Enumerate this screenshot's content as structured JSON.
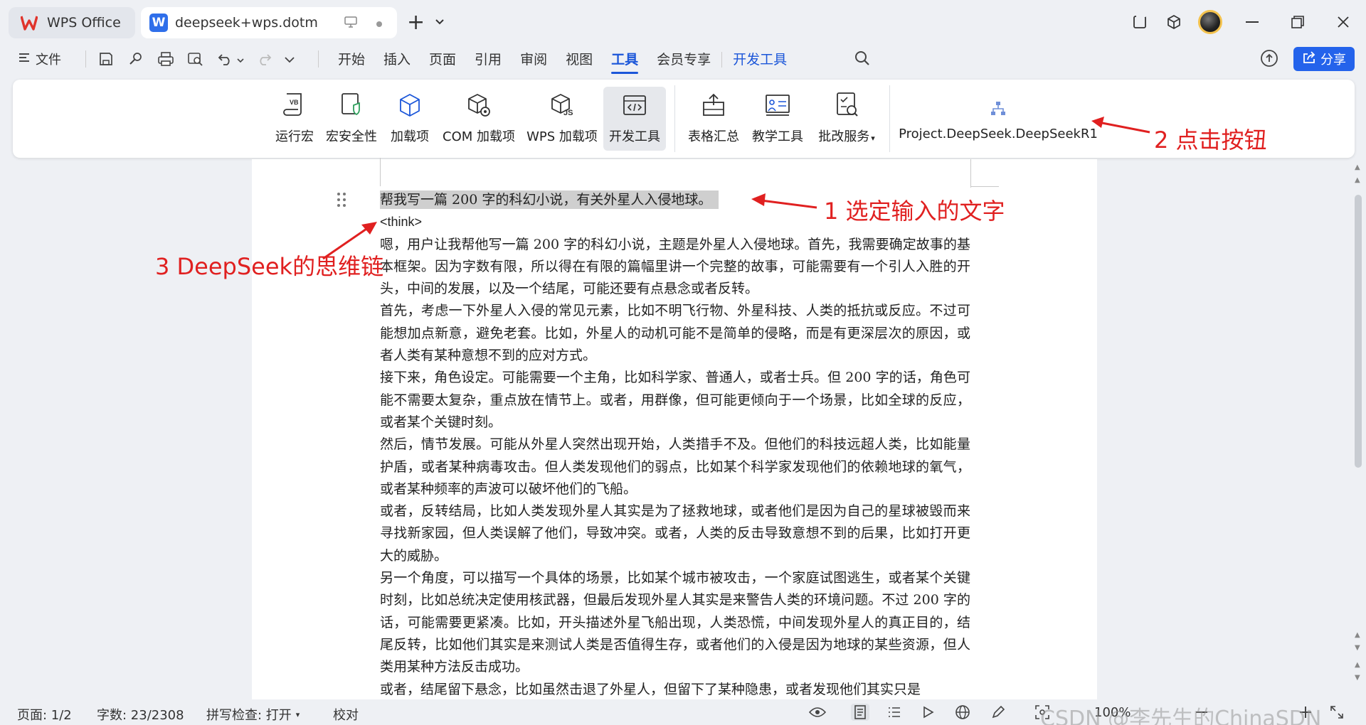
{
  "titlebar": {
    "app_tab": "WPS Office",
    "doc_tab": "deepseek+wps.dotm",
    "new_tab": "+"
  },
  "menubar": {
    "file_label": "文件",
    "items": [
      "开始",
      "插入",
      "页面",
      "引用",
      "审阅",
      "视图",
      "工具",
      "会员专享",
      "开发工具"
    ],
    "active_item": "工具",
    "share_label": "分享"
  },
  "ribbon": {
    "buttons": [
      {
        "label": "运行宏",
        "icon": "vb-script-icon"
      },
      {
        "label": "宏安全性",
        "icon": "macro-shield-icon"
      },
      {
        "label": "加载项",
        "icon": "cube-icon"
      },
      {
        "label": "COM 加载项",
        "icon": "com-addin-icon"
      },
      {
        "label": "WPS 加载项",
        "icon": "wps-addin-icon"
      },
      {
        "label": "开发工具",
        "icon": "dev-tools-icon"
      },
      {
        "label": "表格汇总",
        "icon": "table-summary-icon"
      },
      {
        "label": "教学工具",
        "icon": "teaching-tools-icon"
      },
      {
        "label": "批改服务",
        "icon": "correction-service-icon"
      },
      {
        "label": "Project.DeepSeek.DeepSeekR1",
        "icon": "project-tree-icon"
      }
    ]
  },
  "document": {
    "selected_line": "帮我写一篇 200 字的科幻小说，有关外星人入侵地球。",
    "think_tag": "<think>",
    "paragraphs": [
      "嗯，用户让我帮他写一篇 200 字的科幻小说，主题是外星人入侵地球。首先，我需要确定故事的基本框架。因为字数有限，所以得在有限的篇幅里讲一个完整的故事，可能需要有一个引人入胜的开头，中间的发展，以及一个结尾，可能还要有点悬念或者反转。",
      "首先，考虑一下外星人入侵的常见元素，比如不明飞行物、外星科技、人类的抵抗或反应。不过可能想加点新意，避免老套。比如，外星人的动机可能不是简单的侵略，而是有更深层次的原因，或者人类有某种意想不到的应对方式。",
      "接下来，角色设定。可能需要一个主角，比如科学家、普通人，或者士兵。但 200 字的话，角色可能不需要太复杂，重点放在情节上。或者，用群像，但可能更倾向于一个场景，比如全球的反应，或者某个关键时刻。",
      "然后，情节发展。可能从外星人突然出现开始，人类措手不及。但他们的科技远超人类，比如能量护盾，或者某种病毒攻击。但人类发现他们的弱点，比如某个科学家发现他们的依赖地球的氧气，或者某种频率的声波可以破坏他们的飞船。",
      "或者，反转结局，比如人类发现外星人其实是为了拯救地球，或者他们是因为自己的星球被毁而来寻找新家园，但人类误解了他们，导致冲突。或者，人类的反击导致意想不到的后果，比如打开更大的威胁。",
      "另一个角度，可以描写一个具体的场景，比如某个城市被攻击，一个家庭试图逃生，或者某个关键时刻，比如总统决定使用核武器，但最后发现外星人其实是来警告人类的环境问题。不过 200 字的话，可能需要更紧凑。比如，开头描述外星飞船出现，人类恐慌，中间发现外星人的真正目的，结尾反转，比如他们其实是来测试人类是否值得生存，或者他们的入侵是因为地球的某些资源，但人类用某种方法反击成功。",
      "或者，结尾留下悬念，比如虽然击退了外星人，但留下了某种隐患，或者发现他们其实只是"
    ]
  },
  "annotations": {
    "step1": "1 选定输入的文字",
    "step2": "2 点击按钮",
    "step3": "3 DeepSeek的思维链",
    "color": "#e02020"
  },
  "statusbar": {
    "page": "页面: 1/2",
    "words": "字数: 23/2308",
    "spell": "拼写检查: 打开",
    "proof": "校对",
    "zoom": "100%",
    "watermark": "CSDN @李先生的ChinaSDN"
  }
}
